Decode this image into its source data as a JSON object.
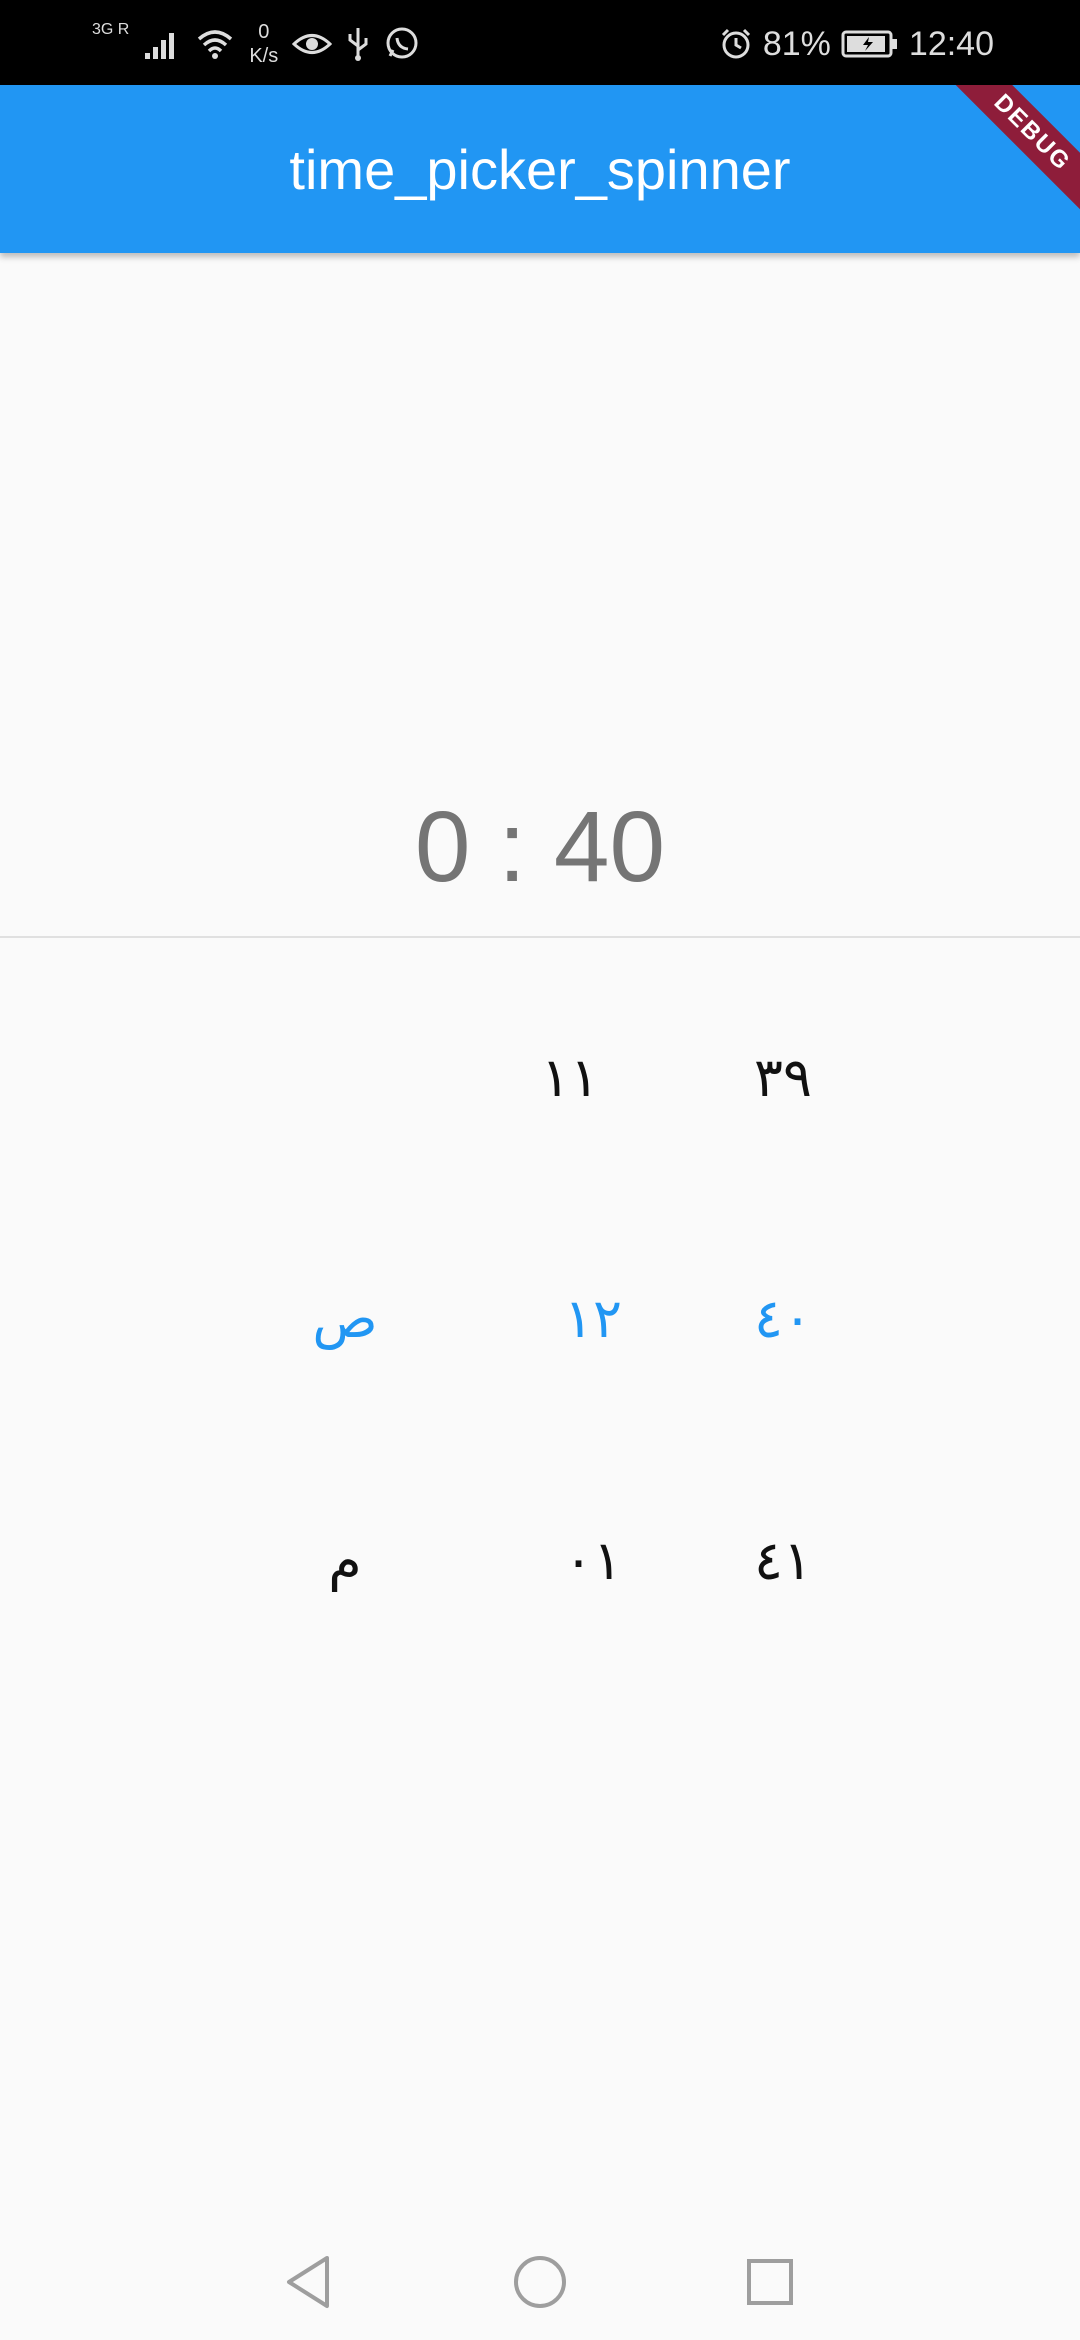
{
  "status_bar": {
    "network_type": "3G R",
    "speed_value": "0",
    "speed_unit": "K/s",
    "battery": "81%",
    "time": "12:40",
    "icons": [
      "signal-icon",
      "wifi-icon",
      "eye-icon",
      "usb-icon",
      "whatsapp-icon",
      "alarm-icon",
      "battery-charging-icon"
    ]
  },
  "app_bar": {
    "title": "time_picker_spinner",
    "debug_banner": "DEBUG"
  },
  "time_display": "0 : 40",
  "spinner": {
    "period_column": [
      "ص",
      "م"
    ],
    "hour_column": [
      "١١",
      "١٢",
      "٠١"
    ],
    "minute_column": [
      "٣٩",
      "٤٠",
      "٤١"
    ],
    "selected": {
      "period": "ص",
      "hour": "١٢",
      "minute": "٤٠"
    },
    "selected_color": "#2196f3"
  },
  "nav_bar": {
    "icons": [
      "back-icon",
      "home-icon",
      "recents-icon"
    ]
  },
  "colors": {
    "app_bar": "#2196f3",
    "background": "#fafafa",
    "time_text": "#757575"
  }
}
